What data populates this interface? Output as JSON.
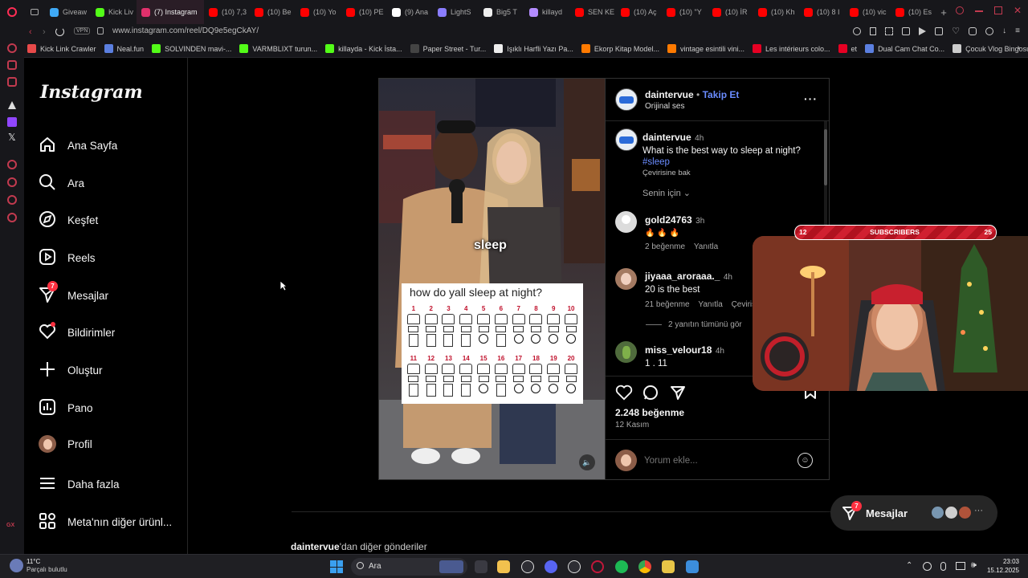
{
  "browser": {
    "tabs": [
      {
        "label": "Giveaw",
        "color": "#3fa9f5"
      },
      {
        "label": "Kick Liv",
        "color": "#53fc18"
      },
      {
        "label": "(7) Instagram",
        "color": "#e1306c",
        "active": true
      },
      {
        "label": "(10) 7,3",
        "color": "#ff0000"
      },
      {
        "label": "(10) Be",
        "color": "#ff0000"
      },
      {
        "label": "(10) Yo",
        "color": "#ff0000"
      },
      {
        "label": "(10) PE",
        "color": "#ff0000"
      },
      {
        "label": "(9) Ana",
        "color": "#ffffff"
      },
      {
        "label": "LightS",
        "color": "#8a7dff"
      },
      {
        "label": "Big5 T",
        "color": "#eeeeee"
      },
      {
        "label": "killayd",
        "color": "#b48cff"
      },
      {
        "label": "SEN KE",
        "color": "#ff0000"
      },
      {
        "label": "(10) Aç",
        "color": "#ff0000"
      },
      {
        "label": "(10) \"Y",
        "color": "#ff0000"
      },
      {
        "label": "(10) İR",
        "color": "#ff0000"
      },
      {
        "label": "(10) Kh",
        "color": "#ff0000"
      },
      {
        "label": "(10) 8 I",
        "color": "#ff0000"
      },
      {
        "label": "(10) vic",
        "color": "#ff0000"
      },
      {
        "label": "(10) Es",
        "color": "#ff0000"
      }
    ],
    "vpn_label": "VPN",
    "url": "www.instagram.com/reel/DQ9e5egCkAY/",
    "bookmarks": [
      {
        "label": "Kick Link Crawler",
        "color": "#e84a4a"
      },
      {
        "label": "Neal.fun",
        "color": "#5b7fe0"
      },
      {
        "label": "SOLVINDEN mavi-...",
        "color": "#53fc18"
      },
      {
        "label": "VARMBLIXT turun...",
        "color": "#53fc18"
      },
      {
        "label": "killayda - Kick İsta...",
        "color": "#53fc18"
      },
      {
        "label": "Paper Street - Tur...",
        "color": "#444444"
      },
      {
        "label": "Işıklı Harfli Yazı Pa...",
        "color": "#eeeeee"
      },
      {
        "label": "Ekorp Kitap Model...",
        "color": "#ff7a00"
      },
      {
        "label": "vintage esintili vini...",
        "color": "#ff7a00"
      },
      {
        "label": "Les intérieurs colo...",
        "color": "#e60023"
      },
      {
        "label": "et",
        "color": "#e60023"
      },
      {
        "label": "Dual Cam Chat Co...",
        "color": "#5b7fe0"
      },
      {
        "label": "Çocuk Vlog Bingosu",
        "color": "#cccccc"
      }
    ]
  },
  "nav": {
    "logo": "Instagram",
    "items": [
      {
        "label": "Ana Sayfa",
        "icon": "home-icon"
      },
      {
        "label": "Ara",
        "icon": "search-icon"
      },
      {
        "label": "Keşfet",
        "icon": "compass-icon"
      },
      {
        "label": "Reels",
        "icon": "reels-icon"
      },
      {
        "label": "Mesajlar",
        "icon": "messenger-icon",
        "badge": "7"
      },
      {
        "label": "Bildirimler",
        "icon": "heart-icon"
      },
      {
        "label": "Oluştur",
        "icon": "plus-icon"
      },
      {
        "label": "Pano",
        "icon": "dashboard-icon"
      },
      {
        "label": "Profil",
        "icon": "profile-avatar"
      },
      {
        "label": "Daha fazla",
        "icon": "menu-icon"
      },
      {
        "label": "Meta'nın diğer ürünl...",
        "icon": "apps-icon"
      }
    ]
  },
  "post": {
    "video": {
      "caption_word": "sleep",
      "poll_title": "how do yall sleep at night?",
      "poll_numbers_row1": [
        "1",
        "2",
        "3",
        "4",
        "5",
        "6",
        "7",
        "8",
        "9",
        "10"
      ],
      "poll_numbers_row2": [
        "11",
        "12",
        "13",
        "14",
        "15",
        "16",
        "17",
        "18",
        "19",
        "20"
      ]
    },
    "header": {
      "username": "daintervue",
      "separator": "•",
      "follow": "Takip Et",
      "audio": "Orijinal ses"
    },
    "caption": {
      "username": "daintervue",
      "time": "4h",
      "text": "What is the best way to sleep at night?",
      "hashtag": "#sleep",
      "translate": "Çevirisine bak"
    },
    "filter": "Senin için",
    "comments": [
      {
        "username": "gold24763",
        "time": "3h",
        "text": "🔥 🔥 🔥",
        "likes": "2 beğenme",
        "reply": "Yanıtla"
      },
      {
        "username": "jiyaaa_aroraaa._",
        "time": "4h",
        "text": "20 is the best",
        "likes": "21 beğenme",
        "reply": "Yanıtla",
        "translate": "Çeviris"
      },
      {
        "username": "miss_velour18",
        "time": "4h",
        "text": "1 . 11"
      }
    ],
    "view_replies": "2 yanıtın tümünü gör",
    "likes": "2.248 beğenme",
    "date": "12 Kasım",
    "comment_placeholder": "Yorum ekle..."
  },
  "more_from": {
    "username": "daintervue",
    "text": "'dan diğer gönderiler"
  },
  "messages_pill": {
    "label": "Mesajlar",
    "badge": "7"
  },
  "webcam": {
    "left_count": "12",
    "label": "SUBSCRIBERS",
    "right_count": "25"
  },
  "taskbar": {
    "temperature": "11°C",
    "weather": "Parçalı bulutlu",
    "search": "Ara",
    "time": "23:03",
    "date": "15.12.2025"
  }
}
